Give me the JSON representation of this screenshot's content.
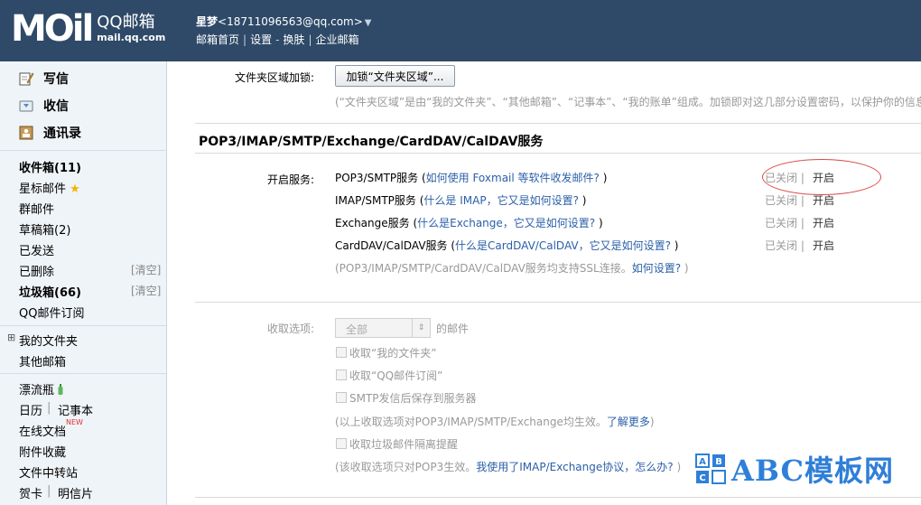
{
  "header": {
    "logo_mark": "MOil",
    "product": "QQ邮箱",
    "domain": "mail.qq.com",
    "user_name": "星梦",
    "user_email": "<18711096563@qq.com>",
    "nav": [
      "邮箱首页",
      "设置",
      "换肤",
      "企业邮箱"
    ],
    "nav_seps": [
      "|",
      "-",
      "|"
    ]
  },
  "sidebar": {
    "compose": "写信",
    "receive": "收信",
    "contacts": "通讯录",
    "folders": [
      {
        "label": "收件箱(11)"
      },
      {
        "label": "星标邮件"
      },
      {
        "label": "群邮件"
      },
      {
        "label": "草稿箱(2)"
      },
      {
        "label": "已发送"
      },
      {
        "label": "已删除"
      },
      {
        "label": "垃圾箱(66)"
      },
      {
        "label": "QQ邮件订阅"
      }
    ],
    "clear_label": "[清空]",
    "my_folders": "我的文件夹",
    "my_folders_toggle": "⊞",
    "other_mail": "其他邮箱",
    "apps": {
      "drift_bottle": "漂流瓶",
      "calendar": "日历",
      "memo": "记事本",
      "online_docs": "在线文档",
      "new_badge": "NEW",
      "attachments": "附件收藏",
      "transfer": "文件中转站",
      "cards": "贺卡",
      "postcard": "明信片",
      "sep": "|"
    }
  },
  "main": {
    "lock_label": "文件夹区域加锁:",
    "lock_button": "加锁“文件夹区域”...",
    "lock_desc": "(“文件夹区域”是由“我的文件夹”、“其他邮箱”、“记事本”、“我的账单”组成。加锁即对这几部分设置密码，以保护你的信息",
    "section_title": "POP3/IMAP/SMTP/Exchange/CardDAV/CalDAV服务",
    "enable_label": "开启服务:",
    "services": [
      {
        "name": "POP3/SMTP服务",
        "paren_open": " (",
        "help": "如何使用 Foxmail 等软件收发邮件?",
        "paren_close": " )"
      },
      {
        "name": "IMAP/SMTP服务",
        "paren_open": " (",
        "help": "什么是 IMAP，它又是如何设置?",
        "paren_close": " )"
      },
      {
        "name": "Exchange服务",
        "paren_open": " (",
        "help": "什么是Exchange，它又是如何设置?",
        "paren_close": " )"
      },
      {
        "name": "CardDAV/CalDAV服务",
        "paren_open": " (",
        "help": "什么是CardDAV/CalDAV，它又是如何设置?",
        "paren_close": " )"
      }
    ],
    "status_off": "已关闭 |",
    "status_on": "开启",
    "ssl_note": "(POP3/IMAP/SMTP/CardDAV/CalDAV服务均支持SSL连接。",
    "ssl_link": "如何设置?",
    "ssl_close": " )",
    "receive_label": "收取选项:",
    "receive_select": "全部",
    "receive_suffix": "的邮件",
    "checkboxes": [
      "收取“我的文件夹”",
      "收取“QQ邮件订阅”",
      "SMTP发信后保存到服务器"
    ],
    "note1": "(以上收取选项对POP3/IMAP/SMTP/Exchange均生效。",
    "note1_link": "了解更多",
    "note1_close": ")",
    "spam_checkbox": "收取垃圾邮件隔离提醒",
    "note2": "(该收取选项只对POP3生效。",
    "note2_link": "我使用了IMAP/Exchange协议，怎么办?",
    "note2_close": " )"
  },
  "watermark": {
    "text": "ABC模板网"
  }
}
